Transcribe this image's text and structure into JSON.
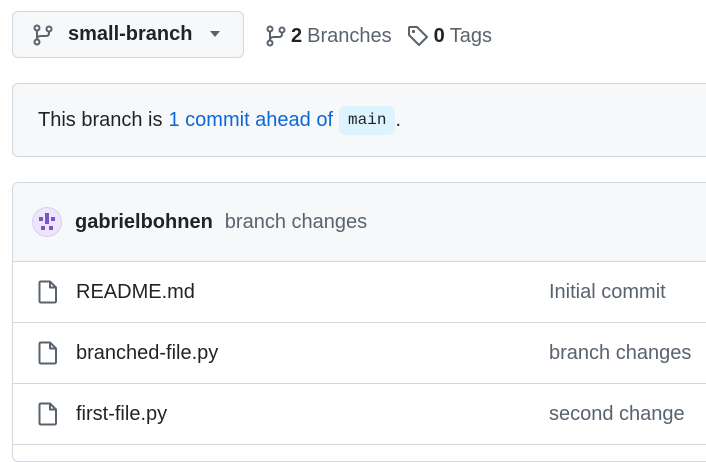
{
  "branch_selector": {
    "name": "small-branch",
    "icons": {
      "branch": "git-branch-icon",
      "caret": "triangle-down-icon"
    }
  },
  "counts": {
    "branches_count": "2",
    "branches_label": "Branches",
    "tags_count": "0",
    "tags_label": "Tags",
    "icons": {
      "branches": "git-branch-icon",
      "tags": "tag-icon"
    }
  },
  "ahead_notice": {
    "prefix": "This branch is",
    "link_text": "1 commit ahead of",
    "base_branch": "main",
    "suffix": "."
  },
  "latest_commit": {
    "author": "gabrielbohnen",
    "message": "branch changes"
  },
  "files": [
    {
      "name": "README.md",
      "commit_message": "Initial commit",
      "icon": "file-icon"
    },
    {
      "name": "branched-file.py",
      "commit_message": "branch changes",
      "icon": "file-icon"
    },
    {
      "name": "first-file.py",
      "commit_message": "second change",
      "icon": "file-icon"
    }
  ],
  "colors": {
    "link": "#0969da",
    "muted_text": "#59636e",
    "border": "#d1d9e0",
    "subtle_bg": "#f6f8fa",
    "code_bg": "#ddf4ff"
  }
}
